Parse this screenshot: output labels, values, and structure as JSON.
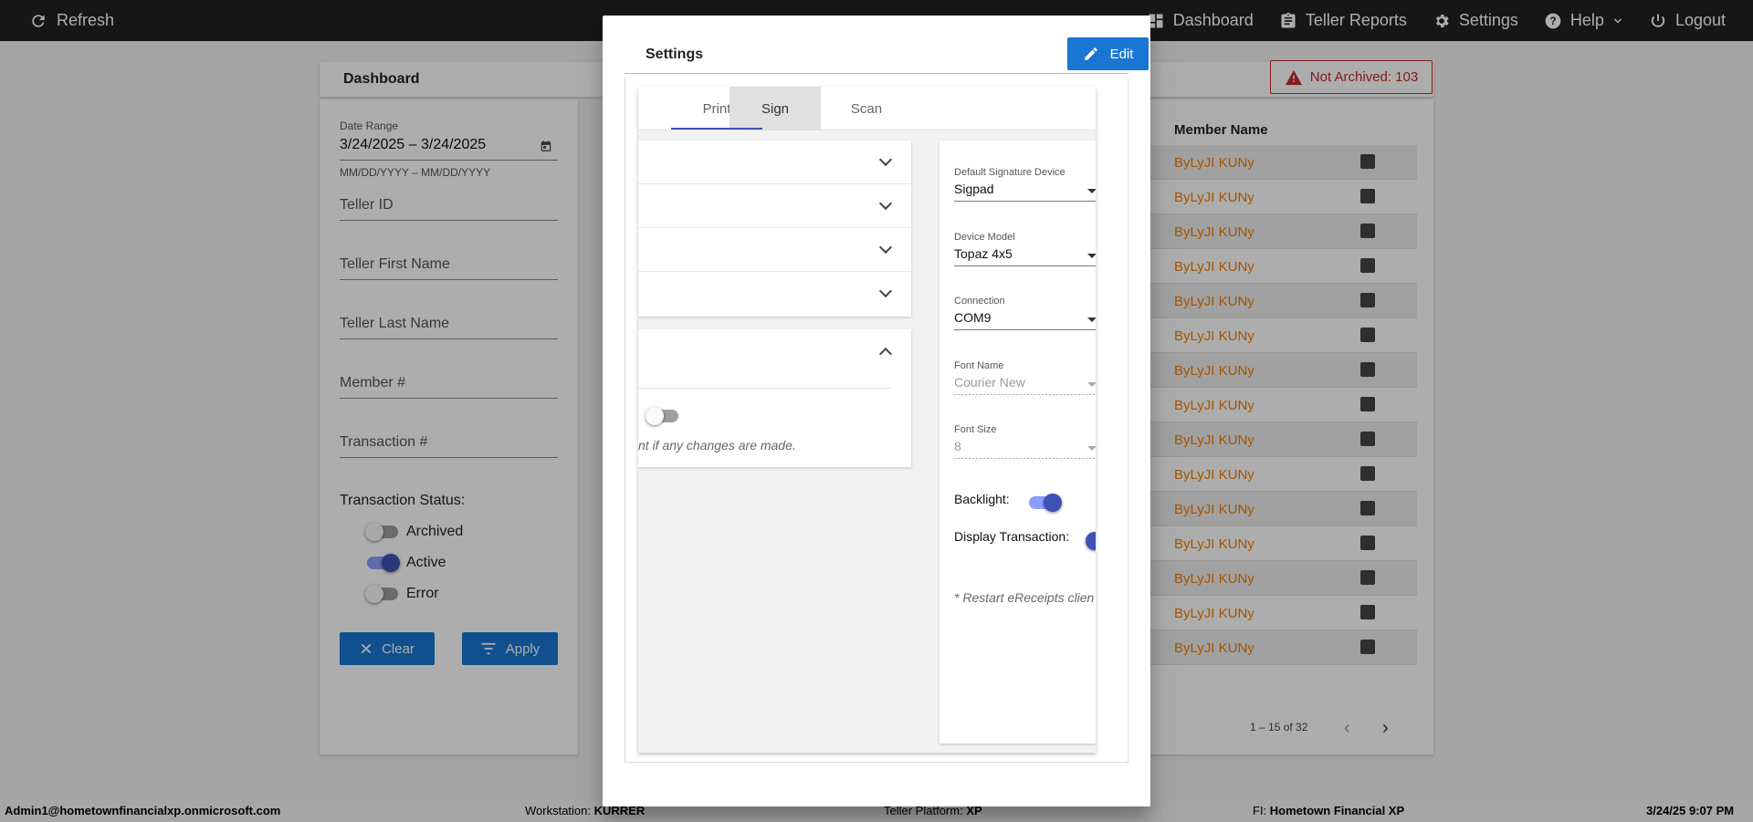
{
  "topbar": {
    "refresh_label": "Refresh",
    "nav": [
      {
        "label": "Dashboard",
        "icon": "dashboard-icon"
      },
      {
        "label": "Teller Reports",
        "icon": "clipboard-icon"
      },
      {
        "label": "Settings",
        "icon": "gear-icon"
      },
      {
        "label": "Help",
        "icon": "help-icon"
      },
      {
        "label": "Logout",
        "icon": "power-icon"
      }
    ]
  },
  "dashboard": {
    "title": "Dashboard",
    "not_archived": "Not Archived: 103"
  },
  "filters": {
    "date_range_label": "Date Range",
    "date_range_value": "3/24/2025 – 3/24/2025",
    "date_hint": "MM/DD/YYYY – MM/DD/YYYY",
    "teller_id": "Teller ID",
    "teller_first": "Teller First Name",
    "teller_last": "Teller Last Name",
    "member_no": "Member #",
    "transaction_no": "Transaction #",
    "status_label": "Transaction Status:",
    "status": [
      {
        "label": "Archived",
        "on": false
      },
      {
        "label": "Active",
        "on": true
      },
      {
        "label": "Error",
        "on": false
      }
    ],
    "clear_label": "Clear",
    "apply_label": "Apply"
  },
  "table": {
    "header_member": "Member Name",
    "rows": [
      "ByLyJI KUNy",
      "ByLyJI KUNy",
      "ByLyJI KUNy",
      "ByLyJI KUNy",
      "ByLyJI KUNy",
      "ByLyJI KUNy",
      "ByLyJI KUNy",
      "ByLyJI KUNy",
      "ByLyJI KUNy",
      "ByLyJI KUNy",
      "ByLyJI KUNy",
      "ByLyJI KUNy",
      "ByLyJI KUNy",
      "ByLyJI KUNy",
      "ByLyJI KUNy"
    ],
    "pager": "1 – 15 of 32"
  },
  "statusbar": {
    "user": "Admin1@hometownfinancialxp.onmicrosoft.com",
    "workstation_label": "Workstation:",
    "workstation": "KURRER",
    "platform_label": "Teller Platform:",
    "platform": "XP",
    "fi_label": "FI:",
    "fi": "Hometown Financial XP",
    "datetime": "3/24/25 9:07 PM"
  },
  "modal": {
    "title": "Settings",
    "edit_label": "Edit",
    "tabs": [
      "Print",
      "Sign",
      "Scan"
    ],
    "active_tab": "Sign",
    "hint": "nt if any changes are made.",
    "device_label": "Default Signature Device",
    "device_value": "Sigpad",
    "model_label": "Device Model",
    "model_value": "Topaz 4x5",
    "connection_label": "Connection",
    "connection_value": "COM9",
    "font_name_label": "Font Name",
    "font_name_value": "Courier New",
    "font_size_label": "Font Size",
    "font_size_value": "8",
    "backlight_label": "Backlight:",
    "display_tx_label": "Display Transaction:",
    "restart_note": "* Restart eReceipts clien"
  },
  "colors": {
    "primary": "#1976d2",
    "toggle_on": "#3f51b5",
    "warning": "#c62828",
    "member_link": "#f57c00"
  }
}
